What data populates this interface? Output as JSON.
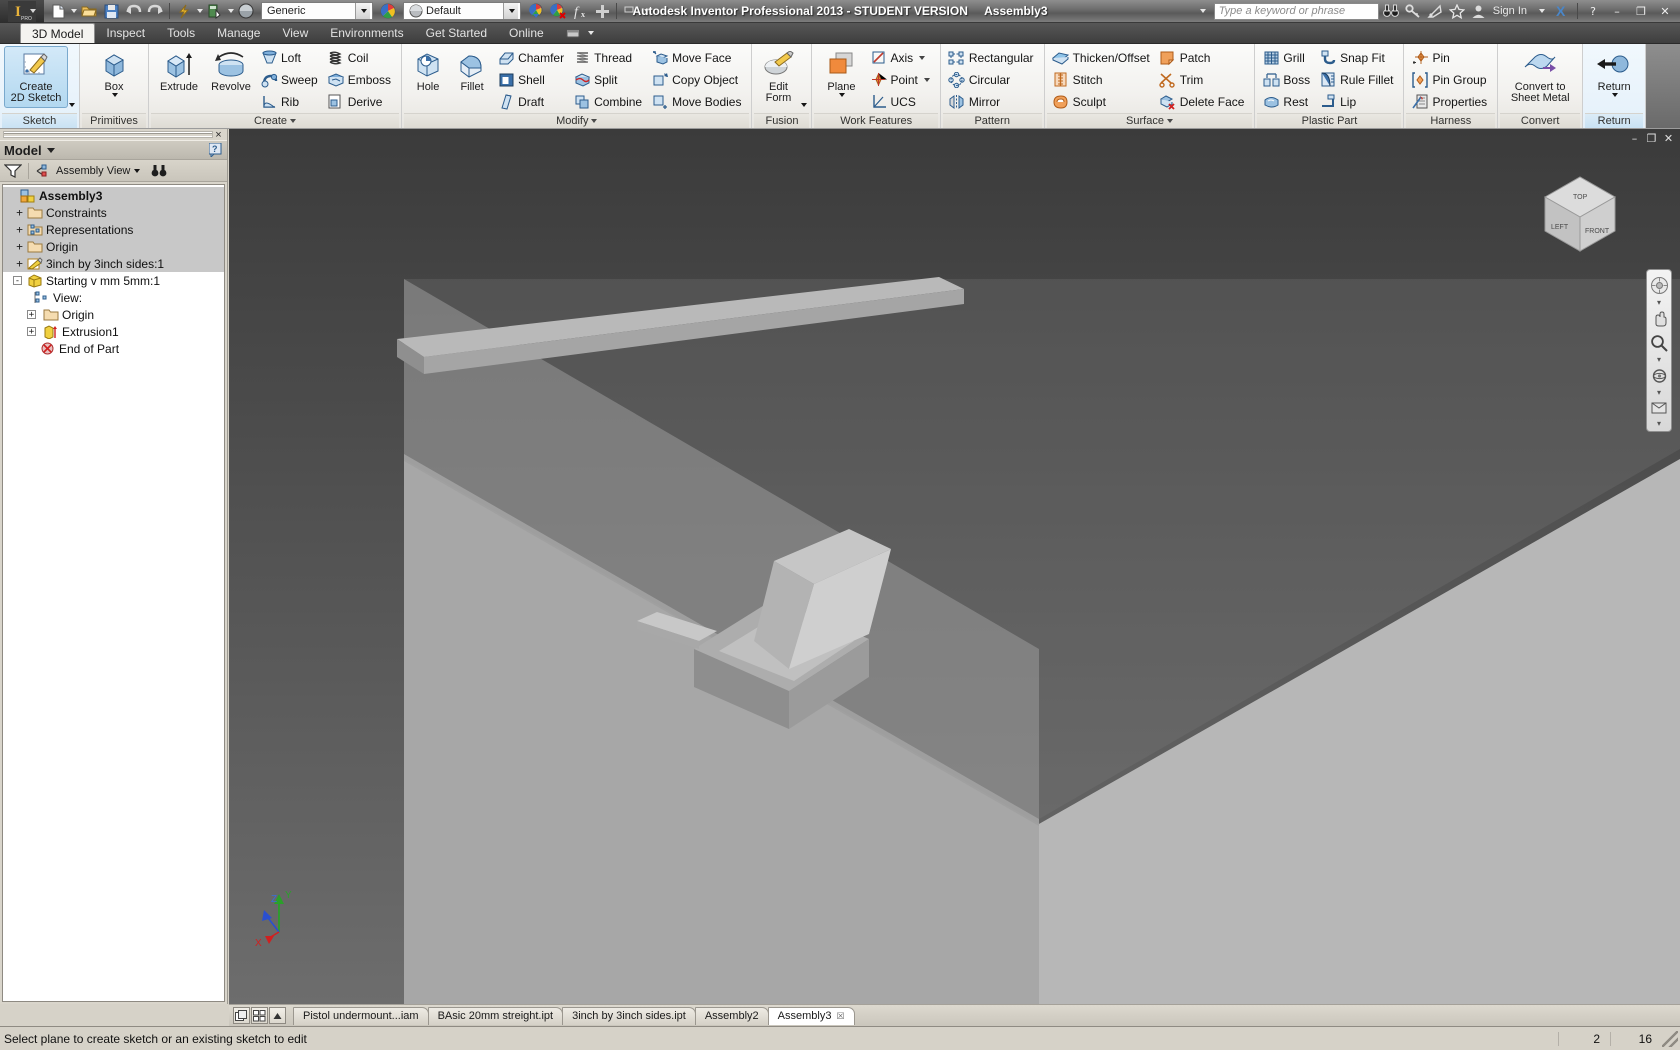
{
  "titlebar": {
    "app_title": "Autodesk Inventor Professional 2013 - STUDENT VERSION",
    "document_title": "Assembly3",
    "material_value": "Generic",
    "appearance_value": "Default",
    "search_placeholder": "Type a keyword or phrase",
    "signin_label": "Sign In",
    "minimize_label": "–",
    "restore_label": "❐",
    "close_label": "✕",
    "help_label": "?",
    "quick_access": [
      "new-icon",
      "open-icon",
      "save-icon",
      "undo-icon",
      "redo-icon",
      "update-icon",
      "select-icon",
      "appearance-icon",
      "material-combo",
      "color-wheel-icon",
      "appearance-combo",
      "adjust-icon",
      "clear-icon",
      "parameters-icon",
      "add-icon"
    ]
  },
  "ribbon_tabs": [
    {
      "label": "3D Model",
      "active": true
    },
    {
      "label": "Inspect",
      "active": false
    },
    {
      "label": "Tools",
      "active": false
    },
    {
      "label": "Manage",
      "active": false
    },
    {
      "label": "View",
      "active": false
    },
    {
      "label": "Environments",
      "active": false
    },
    {
      "label": "Get Started",
      "active": false
    },
    {
      "label": "Online",
      "active": false
    }
  ],
  "ribbon": {
    "panels": [
      {
        "title": "Sketch",
        "highlighted": true,
        "big": [
          {
            "label": "Create\n2D Sketch",
            "icon": "create-sketch-icon",
            "selected": true,
            "dropdown": true
          }
        ],
        "cols": []
      },
      {
        "title": "Primitives",
        "big": [
          {
            "label": "Box",
            "icon": "box-icon",
            "dropdown": true
          }
        ],
        "cols": []
      },
      {
        "title": "Create",
        "title_caret": true,
        "big": [
          {
            "label": "Extrude",
            "icon": "extrude-icon"
          },
          {
            "label": "Revolve",
            "icon": "revolve-icon"
          }
        ],
        "cols": [
          [
            {
              "label": "Loft",
              "icon": "loft-icon"
            },
            {
              "label": "Sweep",
              "icon": "sweep-icon"
            },
            {
              "label": "Rib",
              "icon": "rib-icon"
            }
          ],
          [
            {
              "label": "Coil",
              "icon": "coil-icon"
            },
            {
              "label": "Emboss",
              "icon": "emboss-icon"
            },
            {
              "label": "Derive",
              "icon": "derive-icon"
            }
          ]
        ]
      },
      {
        "title": "Modify",
        "title_caret": true,
        "big": [
          {
            "label": "Hole",
            "icon": "hole-icon"
          },
          {
            "label": "Fillet",
            "icon": "fillet-icon"
          }
        ],
        "cols": [
          [
            {
              "label": "Chamfer",
              "icon": "chamfer-icon"
            },
            {
              "label": "Shell",
              "icon": "shell-icon"
            },
            {
              "label": "Draft",
              "icon": "draft-icon"
            }
          ],
          [
            {
              "label": "Thread",
              "icon": "thread-icon"
            },
            {
              "label": "Split",
              "icon": "split-icon"
            },
            {
              "label": "Combine",
              "icon": "combine-icon"
            }
          ],
          [
            {
              "label": "Move Face",
              "icon": "move-face-icon"
            },
            {
              "label": "Copy Object",
              "icon": "copy-object-icon"
            },
            {
              "label": "Move Bodies",
              "icon": "move-bodies-icon"
            }
          ]
        ]
      },
      {
        "title": "Fusion",
        "big": [
          {
            "label": "Edit\nForm",
            "icon": "edit-form-icon",
            "dropdown": true
          }
        ],
        "cols": []
      },
      {
        "title": "Work Features",
        "big": [
          {
            "label": "Plane",
            "icon": "plane-icon",
            "dropdown": true
          }
        ],
        "cols": [
          [
            {
              "label": "Axis",
              "icon": "axis-icon",
              "dd": true
            },
            {
              "label": "Point",
              "icon": "point-icon",
              "dd": true
            },
            {
              "label": "UCS",
              "icon": "ucs-icon"
            }
          ]
        ]
      },
      {
        "title": "Pattern",
        "big": [],
        "cols": [
          [
            {
              "label": "Rectangular",
              "icon": "rectangular-pattern-icon"
            },
            {
              "label": "Circular",
              "icon": "circular-pattern-icon"
            },
            {
              "label": "Mirror",
              "icon": "mirror-icon"
            }
          ]
        ]
      },
      {
        "title": "Surface",
        "title_caret": true,
        "big": [],
        "cols": [
          [
            {
              "label": "Thicken/Offset",
              "icon": "thicken-offset-icon"
            },
            {
              "label": "Stitch",
              "icon": "stitch-icon"
            },
            {
              "label": "Sculpt",
              "icon": "sculpt-icon"
            }
          ],
          [
            {
              "label": "Patch",
              "icon": "patch-icon"
            },
            {
              "label": "Trim",
              "icon": "trim-icon"
            },
            {
              "label": "Delete Face",
              "icon": "delete-face-icon"
            }
          ]
        ]
      },
      {
        "title": "Plastic Part",
        "big": [],
        "cols": [
          [
            {
              "label": "Grill",
              "icon": "grill-icon"
            },
            {
              "label": "Boss",
              "icon": "boss-icon"
            },
            {
              "label": "Rest",
              "icon": "rest-icon"
            }
          ],
          [
            {
              "label": "Snap Fit",
              "icon": "snap-fit-icon"
            },
            {
              "label": "Rule Fillet",
              "icon": "rule-fillet-icon"
            },
            {
              "label": "Lip",
              "icon": "lip-icon"
            }
          ]
        ]
      },
      {
        "title": "Harness",
        "big": [],
        "cols": [
          [
            {
              "label": "Pin",
              "icon": "pin-icon"
            },
            {
              "label": "Pin Group",
              "icon": "pin-group-icon"
            },
            {
              "label": "Properties",
              "icon": "properties-icon"
            }
          ]
        ]
      },
      {
        "title": "Convert",
        "big": [
          {
            "label": "Convert to\nSheet Metal",
            "icon": "convert-sheet-metal-icon"
          }
        ],
        "cols": []
      },
      {
        "title": "Return",
        "highlighted": true,
        "big": [
          {
            "label": "Return",
            "icon": "return-icon",
            "dropdown": true
          }
        ],
        "cols": []
      }
    ]
  },
  "browser": {
    "panel_title": "Model",
    "close_label": "×",
    "help_label": "?",
    "filter_icon": "filter-icon",
    "view_selector": "Assembly View",
    "find_icon": "binoculars-icon",
    "tree": [
      {
        "label": "Assembly3",
        "icon": "assembly-icon",
        "indent": 0,
        "expander": "",
        "bold": true,
        "shaded": true
      },
      {
        "label": "Constraints",
        "icon": "folder-icon",
        "indent": 1,
        "expander": "+",
        "shaded": true
      },
      {
        "label": "Representations",
        "icon": "representations-icon",
        "indent": 1,
        "expander": "+",
        "shaded": true
      },
      {
        "label": "Origin",
        "icon": "folder-icon",
        "indent": 1,
        "expander": "+",
        "shaded": true
      },
      {
        "label": "3inch by 3inch sides:1",
        "icon": "part-sketch-icon",
        "indent": 1,
        "expander": "+",
        "shaded": true
      },
      {
        "label": "Starting v mm 5mm:1",
        "icon": "part-icon",
        "indent": 1,
        "expander": "-",
        "shaded": false
      },
      {
        "label": "View:",
        "icon": "representations-icon",
        "indent": 2,
        "expander": "",
        "shaded": false
      },
      {
        "label": "Origin",
        "icon": "folder-icon",
        "indent": 2,
        "expander": "+",
        "shaded": false
      },
      {
        "label": "Extrusion1",
        "icon": "extrusion-icon",
        "indent": 2,
        "expander": "+",
        "shaded": false
      },
      {
        "label": "End of Part",
        "icon": "end-of-part-icon",
        "indent": 2,
        "expander": "",
        "shaded": false
      }
    ]
  },
  "viewcube": {
    "top_label": "TOP",
    "left_label": "LEFT",
    "front_label": "FRONT"
  },
  "navbar": {
    "tools": [
      "full-navigation-wheel-icon",
      "pan-icon",
      "zoom-icon",
      "orbit-icon",
      "look-at-icon"
    ]
  },
  "axis_triad": {
    "x": "X",
    "y": "Y",
    "z": "Z"
  },
  "document_tabs": {
    "layout_icon": "tile-windows-icon",
    "grid_icon": "grid-windows-icon",
    "scroll_icon": "scroll-up-icon",
    "tabs": [
      {
        "label": "Pistol undermount...iam",
        "active": false,
        "closable": false
      },
      {
        "label": "BAsic 20mm streight.ipt",
        "active": false,
        "closable": false
      },
      {
        "label": "3inch by 3inch sides.ipt",
        "active": false,
        "closable": false
      },
      {
        "label": "Assembly2",
        "active": false,
        "closable": false
      },
      {
        "label": "Assembly3",
        "active": true,
        "closable": true,
        "close_label": "☒"
      }
    ]
  },
  "statusbar": {
    "message": "Select plane to create sketch or an existing sketch to edit",
    "count_1": "2",
    "count_2": "16"
  },
  "colors": {
    "accent": "#b3d8f0",
    "ribbon_bg": "#f2f1ee",
    "browser_bg": "#d9d5cb",
    "canvas_dark": "#4a4a4a",
    "canvas_light": "#a9a9a9",
    "orange": "#e8792b",
    "blue": "#3a6fa8"
  }
}
